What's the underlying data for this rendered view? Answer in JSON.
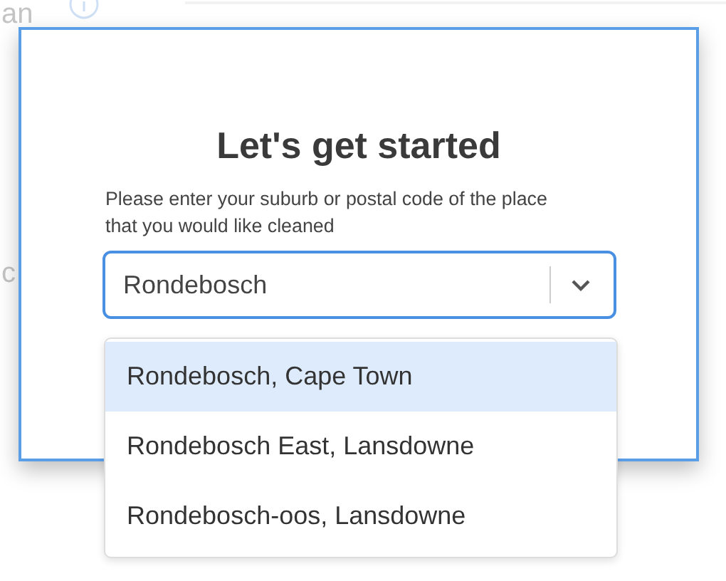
{
  "background": {
    "heading_fragment": "an",
    "label_fragment": "c"
  },
  "dialog": {
    "title": "Let's get started",
    "prompt": "Please enter your suburb or postal code of the place that you would like cleaned",
    "search": {
      "value": "Rondebosch"
    },
    "suggestions": [
      {
        "label": "Rondebosch, Cape Town",
        "selected": true
      },
      {
        "label": "Rondebosch East, Lansdowne",
        "selected": false
      },
      {
        "label": "Rondebosch-oos, Lansdowne",
        "selected": false
      }
    ]
  }
}
